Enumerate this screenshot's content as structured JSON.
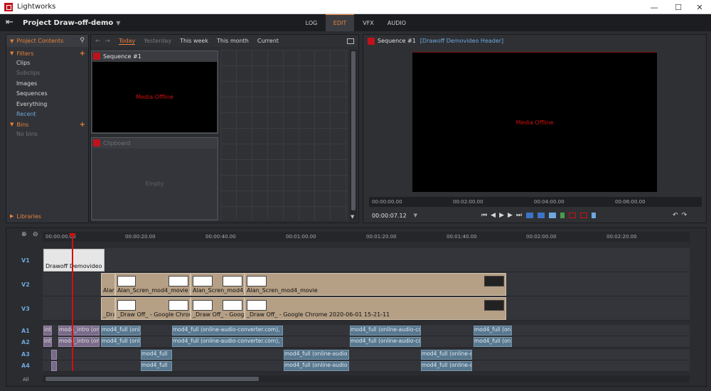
{
  "window": {
    "title": "Lightworks",
    "min": "—",
    "max": "☐",
    "close": "✕"
  },
  "menubar": {
    "project": "Project Draw-off-demo",
    "project_dd": "▼",
    "tabs": [
      "LOG",
      "EDIT",
      "VFX",
      "AUDIO"
    ],
    "active_tab": "EDIT"
  },
  "left": {
    "header": "Project Contents",
    "filters_label": "Filters",
    "filters": [
      "Clips",
      "Subclips",
      "Images",
      "Sequences",
      "Everything",
      "Recent"
    ],
    "bins_label": "Bins",
    "bins_empty": "No bins",
    "libraries_label": "Libraries"
  },
  "browser": {
    "date_filters": [
      "Today",
      "Yesterday",
      "This week",
      "This month",
      "Current"
    ],
    "active_filter": "Today",
    "seq_card": {
      "title": "Sequence #1",
      "status": "Media Offline"
    },
    "clip_card": {
      "title": "Clipboard",
      "status": "Empty"
    }
  },
  "viewer": {
    "title": "Sequence #1",
    "header": "[Drawoff Demovideo Header]",
    "status": "Media Offline",
    "ruler": [
      "00:00:00.00",
      "00:02:00.00",
      "00:04:00.00",
      "00:06:00.00"
    ],
    "timecode": "00:00:07.12",
    "tc_dd": "▼"
  },
  "timeline": {
    "ruler": [
      "00:00:00.00",
      "00:00:20.00",
      "00:00:40.00",
      "00:01:00.00",
      "00:01:20.00",
      "00:01:40.00",
      "00:02:00.00",
      "00:02:20.00"
    ],
    "tracks": [
      "V1",
      "V2",
      "V3",
      "A1",
      "A2",
      "A3",
      "A4",
      "All"
    ],
    "v1_clip": "Drawoff Demovideo He",
    "v2_clips": [
      "Alan",
      "Alan_Scren_mod4_movie",
      "Alan_Scren_mod4_",
      "Alan_Scren_mod4_movie"
    ],
    "v3_clips": [
      "_Dra",
      "_Draw Off_ - Google Chrom",
      "_Draw Off_ - Goog",
      "_Draw Off_ - Google Chrome 2020-06-01 15-21-11"
    ],
    "a1_clips": [
      "intro",
      "mod4_intro (on",
      "mod4_full (onl",
      "mod4_full (online-audio-converter.com),",
      "mod4_full (online-audio-co",
      "mod4_full (on"
    ],
    "a2_clips": [
      "intro",
      "mod4_intro (on",
      "mod4_full (onl",
      "mod4_full (online-audio-converter.com),",
      "mod4_full (online-audio-co",
      "mod4_full (on"
    ],
    "a3_clips": [
      "mod4_full",
      "mod4_full (online-audio",
      "mod4_full (online-a"
    ],
    "a4_clips": [
      "mod4_full",
      "mod4_full (online-audio",
      "mod4_full (online-a"
    ]
  }
}
